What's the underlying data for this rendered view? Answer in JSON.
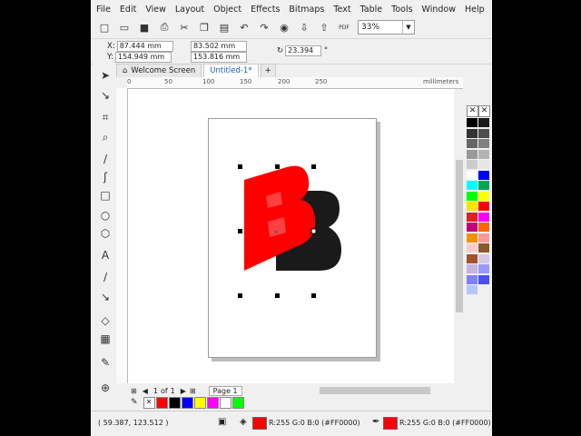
{
  "menu": [
    "File",
    "Edit",
    "View",
    "Layout",
    "Object",
    "Effects",
    "Bitmaps",
    "Text",
    "Table",
    "Tools",
    "Window",
    "Help"
  ],
  "toolbar": {
    "zoom": "33%",
    "pdf_label": "PDF"
  },
  "properties": {
    "x_label": "X:",
    "x": "87.444 mm",
    "y_label": "Y:",
    "y": "154.949 mm",
    "w": "83.502 mm",
    "h": "153.816 mm",
    "angle": "23.394",
    "angle_unit": "°"
  },
  "tabs": [
    {
      "label": "Welcome Screen",
      "active": false
    },
    {
      "label": "Untitled-1*",
      "active": true
    }
  ],
  "ruler": {
    "ticks": [
      "0",
      "50",
      "100",
      "150",
      "200",
      "250"
    ],
    "unit": "millimeters"
  },
  "artwork": {
    "letter": "B",
    "front_color": "#ff0000",
    "shadow_color": "#1a1a1a"
  },
  "pagenav": {
    "current": "1",
    "of_label": "of",
    "total": "1",
    "page_tab": "Page 1"
  },
  "document_palette": [
    "#ff0000",
    "#000000",
    "#0000ff",
    "#ffff00",
    "#ff00ff",
    "#ffffff",
    "#00ff00"
  ],
  "palette_colors": [
    "#000000",
    "#1a1a1a",
    "#333333",
    "#4d4d4d",
    "#666666",
    "#808080",
    "#999999",
    "#b3b3b3",
    "#cccccc",
    "#e6e6e6",
    "#ffffff",
    "#0000ff",
    "#00ffff",
    "#00a651",
    "#00ff00",
    "#ffff00",
    "#f7e400",
    "#ff0000",
    "#e31e24",
    "#ff00ff",
    "#c2007a",
    "#ff6600",
    "#f39200",
    "#ff9999",
    "#ffcccc",
    "#8b5a2b",
    "#a0522d",
    "#d8c8e8",
    "#c7b3de",
    "#9999ff",
    "#7f7fff",
    "#4d4dff",
    "#b3c6ff"
  ],
  "status": {
    "cursor": "( 59.387, 123.512 )",
    "fill_text": "R:255 G:0 B:0 (#FF0000)",
    "outline_text": "R:255 G:0 B:0 (#FF0000)"
  }
}
